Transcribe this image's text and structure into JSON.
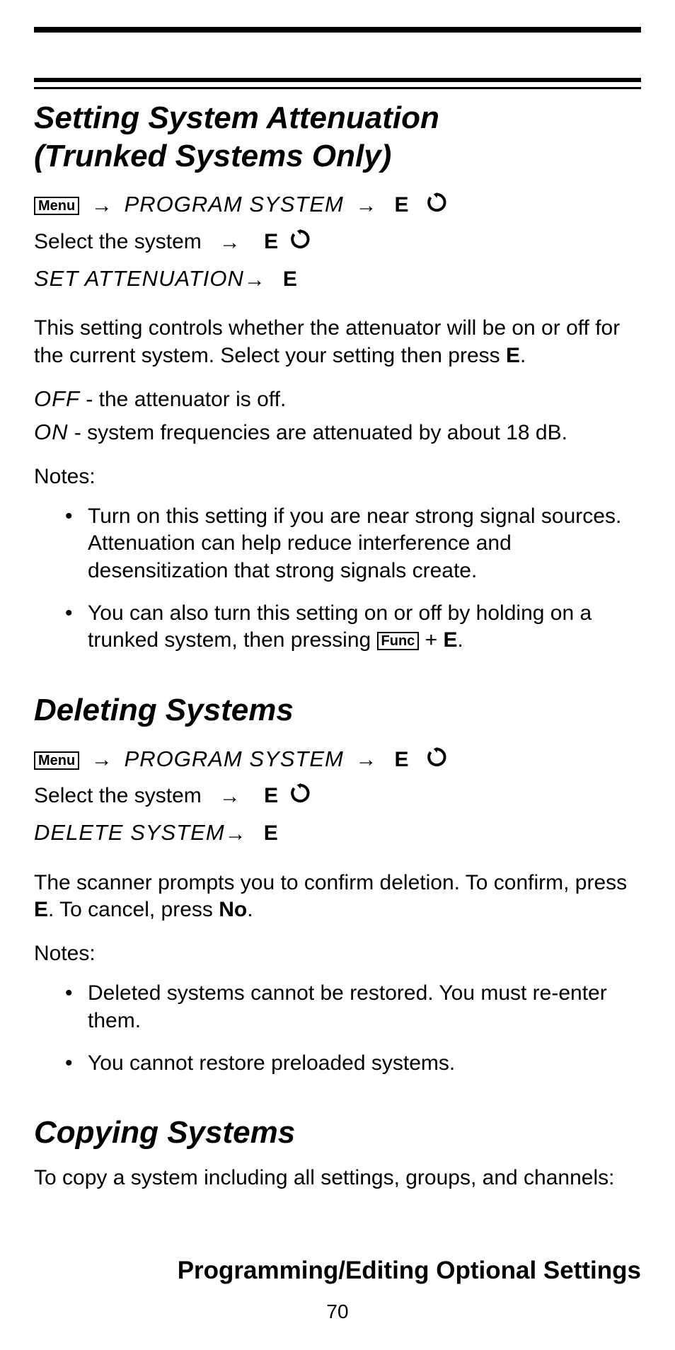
{
  "rules": {},
  "section1": {
    "title_line1": "Setting System Attenuation",
    "title_line2": "(Trunked Systems Only)",
    "nav": {
      "menu_badge": "Menu",
      "program_system": "PROGRAM SYSTEM",
      "select_system": "Select the system",
      "set_attenuation": "SET ATTENUATION",
      "key_E": "E"
    },
    "body1_a": "This setting controls whether the attenuator will be on or off for the current system. Select your setting then press ",
    "body1_key": "E",
    "body1_b": ".",
    "opt_off_label": "OFF",
    "opt_off_text": " - the attenuator is off.",
    "opt_on_label": "ON",
    "opt_on_text": " - system frequencies are attenuated by about 18 dB.",
    "notes_label": "Notes:",
    "note1": "Turn on this setting if you are near strong signal sources. Attenuation can help reduce interference and desensitization that strong signals create.",
    "note2_a": "You can also turn this setting on or off by holding on a trunked system, then pressing ",
    "func_badge": "Func",
    "note2_plus": "  + ",
    "note2_key": "E",
    "note2_b": "."
  },
  "section2": {
    "title": "Deleting Systems",
    "nav": {
      "menu_badge": "Menu",
      "program_system": "PROGRAM SYSTEM",
      "select_system": "Select the system",
      "delete_system": "DELETE SYSTEM",
      "key_E": "E"
    },
    "body_a": "The scanner prompts you to confirm deletion. To confirm, press ",
    "body_key1": "E",
    "body_b": ". To cancel, press ",
    "body_key2": "No",
    "body_c": ".",
    "notes_label": "Notes:",
    "note1": "Deleted systems cannot be restored. You must re-enter them.",
    "note2": "You cannot restore preloaded systems."
  },
  "section3": {
    "title": "Copying Systems",
    "body": "To copy a system including all settings, groups, and channels:"
  },
  "footer": {
    "title": "Programming/Editing Optional Settings",
    "page": "70"
  }
}
